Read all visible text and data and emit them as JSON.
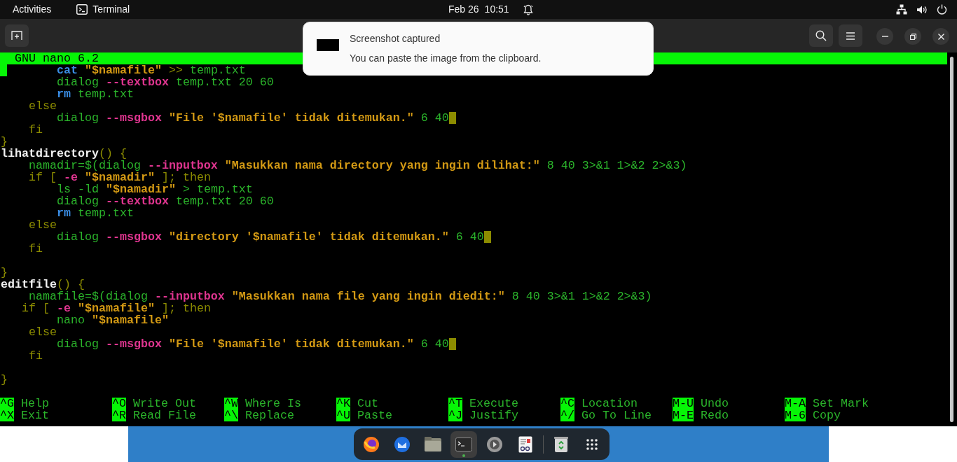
{
  "top_bar": {
    "activities": "Activities",
    "app_name": "Terminal",
    "date": "Feb 26",
    "time": "10:51"
  },
  "notification": {
    "title": "Screenshot captured",
    "body": "You can paste the image from the clipboard."
  },
  "editor": {
    "title": "GNU nano 6.2",
    "lines": [
      {
        "marked": true,
        "trailing_space": false,
        "segments": [
          {
            "kind": "keyword",
            "text": "        cat"
          },
          {
            "kind": "string",
            "text": " \"$namafile\""
          },
          {
            "kind": "dim",
            "text": " >> "
          },
          {
            "kind": "plain",
            "text": "temp.txt"
          }
        ]
      },
      {
        "marked": false,
        "trailing_space": false,
        "segments": [
          {
            "kind": "plain",
            "text": "        dialog "
          },
          {
            "kind": "option",
            "text": "--textbox"
          },
          {
            "kind": "plain",
            "text": " temp.txt 20 60"
          }
        ]
      },
      {
        "marked": false,
        "trailing_space": false,
        "segments": [
          {
            "kind": "keyword",
            "text": "        rm"
          },
          {
            "kind": "plain",
            "text": " temp.txt"
          }
        ]
      },
      {
        "marked": false,
        "trailing_space": false,
        "segments": [
          {
            "kind": "dim",
            "text": "    else"
          }
        ]
      },
      {
        "marked": false,
        "trailing_space": true,
        "segments": [
          {
            "kind": "plain",
            "text": "        dialog "
          },
          {
            "kind": "option",
            "text": "--msgbox"
          },
          {
            "kind": "string",
            "text": " \"File '$namafile' tidak ditemukan.\""
          },
          {
            "kind": "plain",
            "text": " 6 40"
          }
        ]
      },
      {
        "marked": false,
        "trailing_space": false,
        "segments": [
          {
            "kind": "dim",
            "text": "    fi"
          }
        ]
      },
      {
        "marked": false,
        "trailing_space": false,
        "segments": [
          {
            "kind": "dim",
            "text": "}"
          }
        ]
      },
      {
        "marked": false,
        "trailing_space": false,
        "segments": [
          {
            "kind": "function",
            "text": "lihatdirectory"
          },
          {
            "kind": "dim",
            "text": "() {"
          }
        ]
      },
      {
        "marked": false,
        "trailing_space": false,
        "segments": [
          {
            "kind": "plain",
            "text": "    namadir=$(dialog "
          },
          {
            "kind": "option",
            "text": "--inputbox"
          },
          {
            "kind": "string",
            "text": " \"Masukkan nama directory yang ingin dilihat:\""
          },
          {
            "kind": "plain",
            "text": " 8 40 3>&1 1>&2 2>&3)"
          }
        ]
      },
      {
        "marked": false,
        "trailing_space": false,
        "segments": [
          {
            "kind": "dim",
            "text": "    if [ "
          },
          {
            "kind": "option",
            "text": "-e"
          },
          {
            "kind": "string",
            "text": " \"$namadir\""
          },
          {
            "kind": "dim",
            "text": " ]; then"
          }
        ]
      },
      {
        "marked": false,
        "trailing_space": false,
        "segments": [
          {
            "kind": "plain",
            "text": "        ls -ld "
          },
          {
            "kind": "string",
            "text": "\"$namadir\""
          },
          {
            "kind": "plain",
            "text": " > temp.txt"
          }
        ]
      },
      {
        "marked": false,
        "trailing_space": false,
        "segments": [
          {
            "kind": "plain",
            "text": "        dialog "
          },
          {
            "kind": "option",
            "text": "--textbox"
          },
          {
            "kind": "plain",
            "text": " temp.txt 20 60"
          }
        ]
      },
      {
        "marked": false,
        "trailing_space": false,
        "segments": [
          {
            "kind": "keyword",
            "text": "        rm"
          },
          {
            "kind": "plain",
            "text": " temp.txt"
          }
        ]
      },
      {
        "marked": false,
        "trailing_space": false,
        "segments": [
          {
            "kind": "dim",
            "text": "    else"
          }
        ]
      },
      {
        "marked": false,
        "trailing_space": true,
        "segments": [
          {
            "kind": "plain",
            "text": "        dialog "
          },
          {
            "kind": "option",
            "text": "--msgbox"
          },
          {
            "kind": "string",
            "text": " \"directory '$namafile' tidak ditemukan.\""
          },
          {
            "kind": "plain",
            "text": " 6 40"
          }
        ]
      },
      {
        "marked": false,
        "trailing_space": false,
        "segments": [
          {
            "kind": "dim",
            "text": "    fi"
          }
        ]
      },
      {
        "marked": false,
        "trailing_space": false
      },
      {
        "marked": false,
        "trailing_space": false,
        "segments": [
          {
            "kind": "dim",
            "text": "}"
          }
        ]
      },
      {
        "marked": false,
        "trailing_space": false,
        "segments": [
          {
            "kind": "function",
            "text": "editfile"
          },
          {
            "kind": "dim",
            "text": "() {"
          }
        ]
      },
      {
        "marked": false,
        "trailing_space": false,
        "segments": [
          {
            "kind": "plain",
            "text": "    namafile=$(dialog "
          },
          {
            "kind": "option",
            "text": "--inputbox"
          },
          {
            "kind": "string",
            "text": " \"Masukkan nama file yang ingin diedit:\""
          },
          {
            "kind": "plain",
            "text": " 8 40 3>&1 1>&2 2>&3)"
          }
        ]
      },
      {
        "marked": false,
        "trailing_space": false,
        "segments": [
          {
            "kind": "dim",
            "text": "   if [ "
          },
          {
            "kind": "option",
            "text": "-e"
          },
          {
            "kind": "string",
            "text": " \"$namafile\""
          },
          {
            "kind": "dim",
            "text": " ]; then"
          }
        ]
      },
      {
        "marked": false,
        "trailing_space": false,
        "segments": [
          {
            "kind": "plain",
            "text": "        nano "
          },
          {
            "kind": "string",
            "text": "\"$namafile\""
          }
        ]
      },
      {
        "marked": false,
        "trailing_space": false,
        "segments": [
          {
            "kind": "dim",
            "text": "    else"
          }
        ]
      },
      {
        "marked": false,
        "trailing_space": true,
        "segments": [
          {
            "kind": "plain",
            "text": "        dialog "
          },
          {
            "kind": "option",
            "text": "--msgbox"
          },
          {
            "kind": "string",
            "text": " \"File '$namafile' tidak ditemukan.\""
          },
          {
            "kind": "plain",
            "text": " 6 40"
          }
        ]
      },
      {
        "marked": false,
        "trailing_space": false,
        "segments": [
          {
            "kind": "dim",
            "text": "    fi"
          }
        ]
      },
      {
        "marked": false,
        "trailing_space": false
      },
      {
        "marked": false,
        "trailing_space": false,
        "segments": [
          {
            "kind": "dim",
            "text": "}"
          }
        ]
      }
    ],
    "shortcuts": [
      {
        "key": "^G",
        "label": "Help"
      },
      {
        "key": "^O",
        "label": "Write Out"
      },
      {
        "key": "^W",
        "label": "Where Is"
      },
      {
        "key": "^K",
        "label": "Cut"
      },
      {
        "key": "^T",
        "label": "Execute"
      },
      {
        "key": "^C",
        "label": "Location"
      },
      {
        "key": "M-U",
        "label": "Undo"
      },
      {
        "key": "M-A",
        "label": "Set Mark"
      },
      {
        "key": "^X",
        "label": "Exit"
      },
      {
        "key": "^R",
        "label": "Read File"
      },
      {
        "key": "^\\",
        "label": "Replace"
      },
      {
        "key": "^U",
        "label": "Paste"
      },
      {
        "key": "^J",
        "label": "Justify"
      },
      {
        "key": "^/",
        "label": "Go To Line"
      },
      {
        "key": "M-E",
        "label": "Redo"
      },
      {
        "key": "M-6",
        "label": "Copy"
      }
    ]
  },
  "dock": {
    "apps": [
      {
        "kind": "browser",
        "running": false
      },
      {
        "kind": "mail",
        "running": false
      },
      {
        "kind": "files",
        "running": false
      },
      {
        "kind": "terminal",
        "running": true
      },
      {
        "kind": "settings",
        "running": false
      },
      {
        "kind": "document",
        "running": false
      },
      {
        "kind": "separator"
      },
      {
        "kind": "trash",
        "running": false
      },
      {
        "kind": "grid",
        "running": false
      }
    ]
  }
}
